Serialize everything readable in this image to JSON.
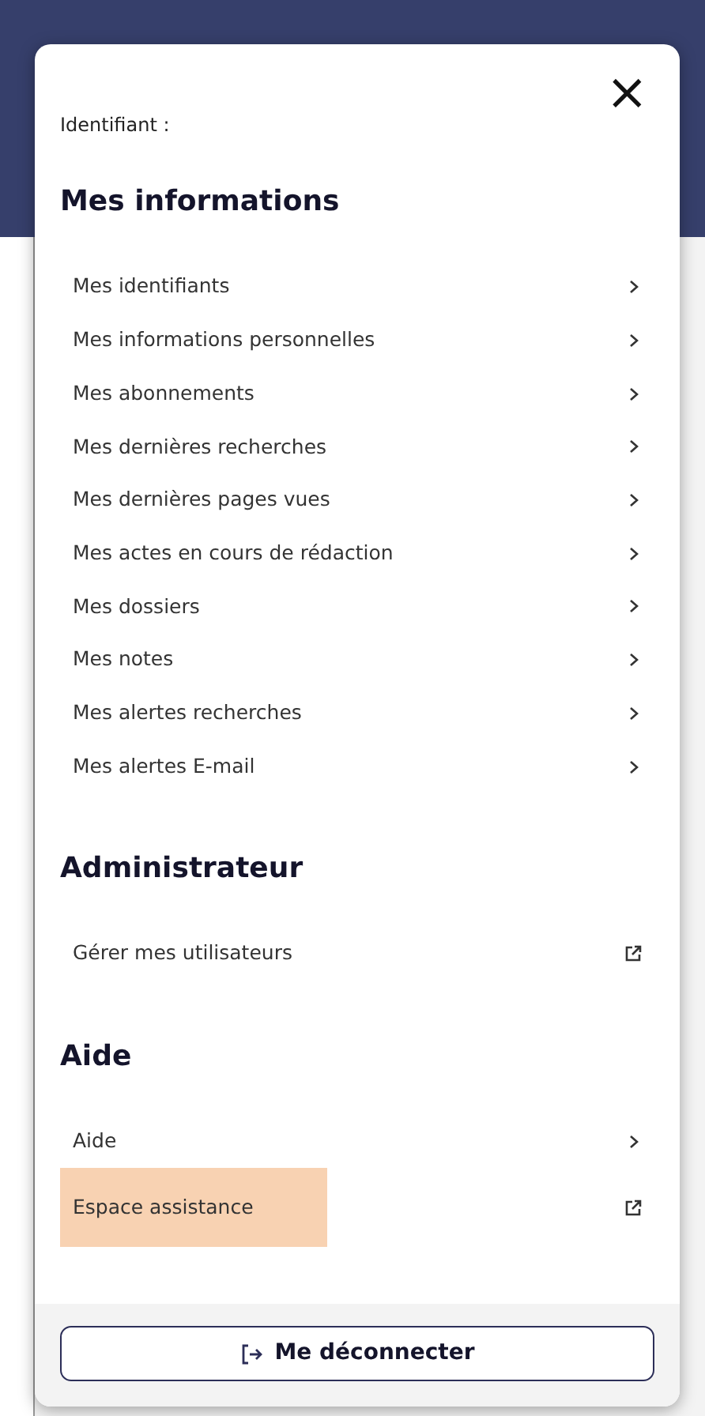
{
  "panel": {
    "close": "×",
    "identifier_label": "Identifiant :",
    "sections": [
      {
        "title": "Mes informations",
        "items": [
          {
            "label": "Mes identifiants",
            "kind": "chevron",
            "highlighted": false
          },
          {
            "label": "Mes informations personnelles",
            "kind": "chevron",
            "highlighted": false
          },
          {
            "label": "Mes abonnements",
            "kind": "chevron",
            "highlighted": false
          },
          {
            "label": "Mes dernières recherches",
            "kind": "chevron",
            "highlighted": false
          },
          {
            "label": "Mes dernières pages vues",
            "kind": "chevron",
            "highlighted": false
          },
          {
            "label": "Mes actes en cours de rédaction",
            "kind": "chevron",
            "highlighted": false
          },
          {
            "label": "Mes dossiers",
            "kind": "chevron",
            "highlighted": false
          },
          {
            "label": "Mes notes",
            "kind": "chevron",
            "highlighted": false
          },
          {
            "label": "Mes alertes recherches",
            "kind": "chevron",
            "highlighted": false
          },
          {
            "label": "Mes alertes E-mail",
            "kind": "chevron",
            "highlighted": false
          }
        ]
      },
      {
        "title": "Administrateur",
        "items": [
          {
            "label": "Gérer mes utilisateurs",
            "kind": "external",
            "highlighted": false
          }
        ]
      },
      {
        "title": "Aide",
        "items": [
          {
            "label": "Aide",
            "kind": "chevron",
            "highlighted": false
          },
          {
            "label": "Espace assistance",
            "kind": "external",
            "highlighted": true
          }
        ]
      }
    ],
    "logout_button": "Me déconnecter"
  }
}
